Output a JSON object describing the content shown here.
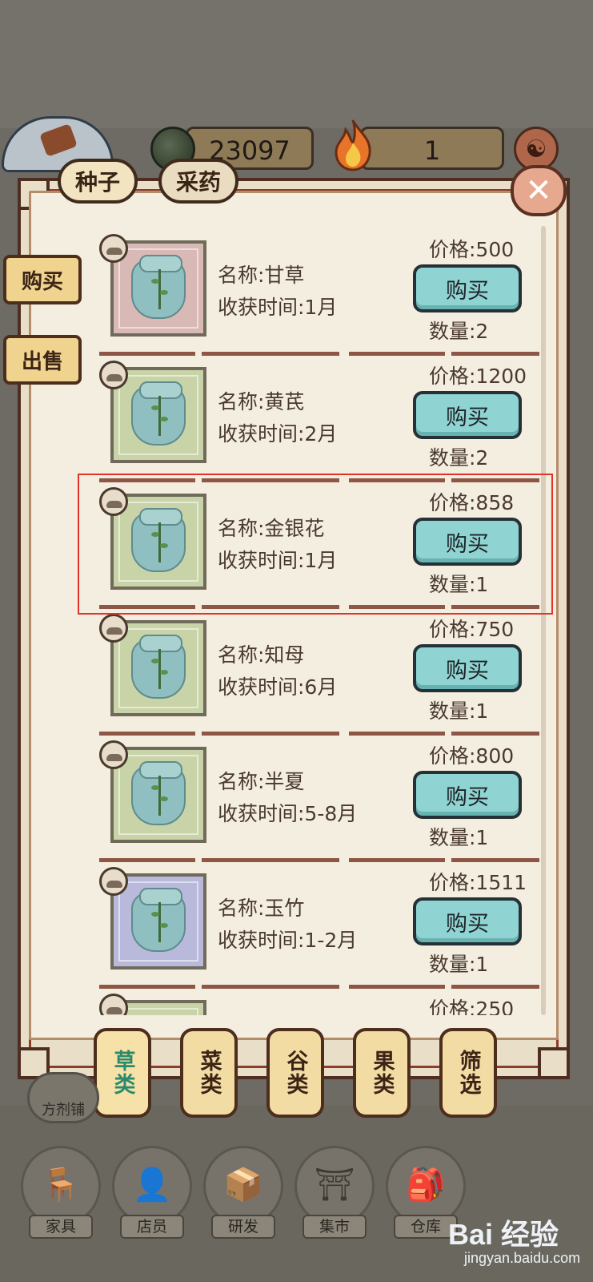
{
  "hud": {
    "coins": "23097",
    "fire": "1",
    "yinyang_glyph": "☯"
  },
  "top_tabs": [
    {
      "label": "种子"
    },
    {
      "label": "采药"
    }
  ],
  "close_glyph": "✕",
  "side_tabs": [
    {
      "label": "购买"
    },
    {
      "label": "出售"
    }
  ],
  "items": [
    {
      "name": "名称:甘草",
      "time": "收获时间:1月",
      "price": "价格:500",
      "qty": "数量:2",
      "buy": "购买",
      "frame_color": "#d9b9b5"
    },
    {
      "name": "名称:黄芪",
      "time": "收获时间:2月",
      "price": "价格:1200",
      "qty": "数量:2",
      "buy": "购买",
      "frame_color": "#c9d3a8"
    },
    {
      "name": "名称:金银花",
      "time": "收获时间:1月",
      "price": "价格:858",
      "qty": "数量:1",
      "buy": "购买",
      "frame_color": "#c9d3a8"
    },
    {
      "name": "名称:知母",
      "time": "收获时间:6月",
      "price": "价格:750",
      "qty": "数量:1",
      "buy": "购买",
      "frame_color": "#c9d3a8"
    },
    {
      "name": "名称:半夏",
      "time": "收获时间:5-8月",
      "price": "价格:800",
      "qty": "数量:1",
      "buy": "购买",
      "frame_color": "#c9d3a8"
    },
    {
      "name": "名称:玉竹",
      "time": "收获时间:1-2月",
      "price": "价格:1511",
      "qty": "数量:1",
      "buy": "购买",
      "frame_color": "#b9b9dc"
    },
    {
      "name": "",
      "time": "",
      "price": "价格:250",
      "qty": "",
      "buy": "",
      "frame_color": "#c9d3a8"
    }
  ],
  "categories": [
    {
      "label": "草类"
    },
    {
      "label": "菜类"
    },
    {
      "label": "谷类"
    },
    {
      "label": "果类"
    },
    {
      "label": "筛选"
    }
  ],
  "shop_badge": "方剂铺",
  "bottom_nav": [
    {
      "label": "家具",
      "icon": "chair-icon",
      "glyph": "🪑"
    },
    {
      "label": "店员",
      "icon": "staff-icon",
      "glyph": "👤"
    },
    {
      "label": "研发",
      "icon": "research-icon",
      "glyph": "📦"
    },
    {
      "label": "集市",
      "icon": "market-icon",
      "glyph": "⛩"
    },
    {
      "label": "仓库",
      "icon": "warehouse-icon",
      "glyph": "🎒"
    }
  ],
  "watermark": {
    "logo": "Bai 经验",
    "sub": "jingyan.baidu.com"
  }
}
